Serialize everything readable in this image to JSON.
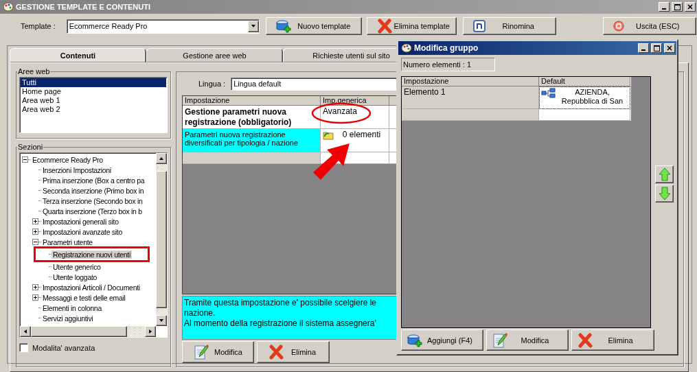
{
  "window": {
    "title": "GESTIONE TEMPLATE E CONTENUTI"
  },
  "toolbar": {
    "template_label": "Template :",
    "template_value": "Ecommerce Ready Pro",
    "buttons": [
      {
        "label": "Nuovo template"
      },
      {
        "label": "Elimina template"
      },
      {
        "label": "Rinomina"
      },
      {
        "label": "Uscita (ESC)"
      }
    ]
  },
  "tabs": [
    {
      "label": "Contenuti",
      "selected": true
    },
    {
      "label": "Gestione aree web",
      "selected": false
    },
    {
      "label": "Richieste utenti sul sito",
      "selected": false
    }
  ],
  "aree_web": {
    "title": "Aree web",
    "items": [
      {
        "label": "Tutti",
        "selected": true
      },
      {
        "label": "Home page",
        "selected": false
      },
      {
        "label": "Area web 1",
        "selected": false
      },
      {
        "label": "Area web 2",
        "selected": false
      }
    ]
  },
  "sezioni": {
    "title": "Sezioni",
    "tree": [
      {
        "label": "Ecommerce Ready Pro",
        "expanded": true,
        "selected": false,
        "children": [
          {
            "label": "Inserzioni Impostazioni",
            "selected": false
          },
          {
            "label": "Prima inserzione (Box a centro pa",
            "selected": false
          },
          {
            "label": "Seconda inserzione (Primo box in",
            "selected": false
          },
          {
            "label": "Terza inserzione (Secondo box in",
            "selected": false
          },
          {
            "label": "Quarta inserzione (Terzo box in b",
            "selected": false
          },
          {
            "label": "Impostazioni generali sito",
            "expanded": false,
            "selected": false
          },
          {
            "label": "Impostazioni avanzate sito",
            "expanded": false,
            "selected": false
          },
          {
            "label": "Parametri utente",
            "expanded": true,
            "selected": false,
            "children": [
              {
                "label": "Registrazione nuovi utenti",
                "selected": true
              },
              {
                "label": "Utente generico",
                "selected": false
              },
              {
                "label": "Utente loggato",
                "selected": false
              }
            ]
          },
          {
            "label": "Impostazioni Articoli / Documenti",
            "expanded": false,
            "selected": false
          },
          {
            "label": "Messaggi e testi delle email",
            "expanded": false,
            "selected": false
          },
          {
            "label": "Elementi in colonna",
            "selected": false
          },
          {
            "label": "Servizi aggiuntivi",
            "selected": false
          }
        ]
      }
    ]
  },
  "advanced_mode": {
    "label": "Modalita' avanzata",
    "checked": false
  },
  "lingua": {
    "label": "Lingua :",
    "value": "Lingua default"
  },
  "settings_table": {
    "columns": [
      "Impostazione",
      "Imp.generica"
    ],
    "rows": [
      {
        "kind": "choice",
        "name": "Gestione parametri nuova registrazione (obbligatorio)",
        "value": "Avanzata",
        "selected": false
      },
      {
        "kind": "group",
        "name": "Parametri nuova registrazione diversificati per tipologia / nazione",
        "value": "0 elementi",
        "selected": true
      }
    ]
  },
  "description": [
    "Tramite questa impostazione e' possibile scelgiere le",
    "nazione.",
    "Al momento della registrazione il sistema assegnera'"
  ],
  "actions": [
    {
      "label": "Modifica"
    },
    {
      "label": "Elimina"
    }
  ],
  "dialog": {
    "title": "Modifica gruppo",
    "count": "Numero elementi : 1",
    "columns": [
      "Impostazione",
      "Default"
    ],
    "rows": [
      {
        "name": "Elemento 1",
        "value": "AZIENDA, Repubblica di San"
      }
    ],
    "buttons": [
      {
        "label": "Aggiungi (F4)"
      },
      {
        "label": "Modifica"
      },
      {
        "label": "Elimina"
      }
    ]
  }
}
